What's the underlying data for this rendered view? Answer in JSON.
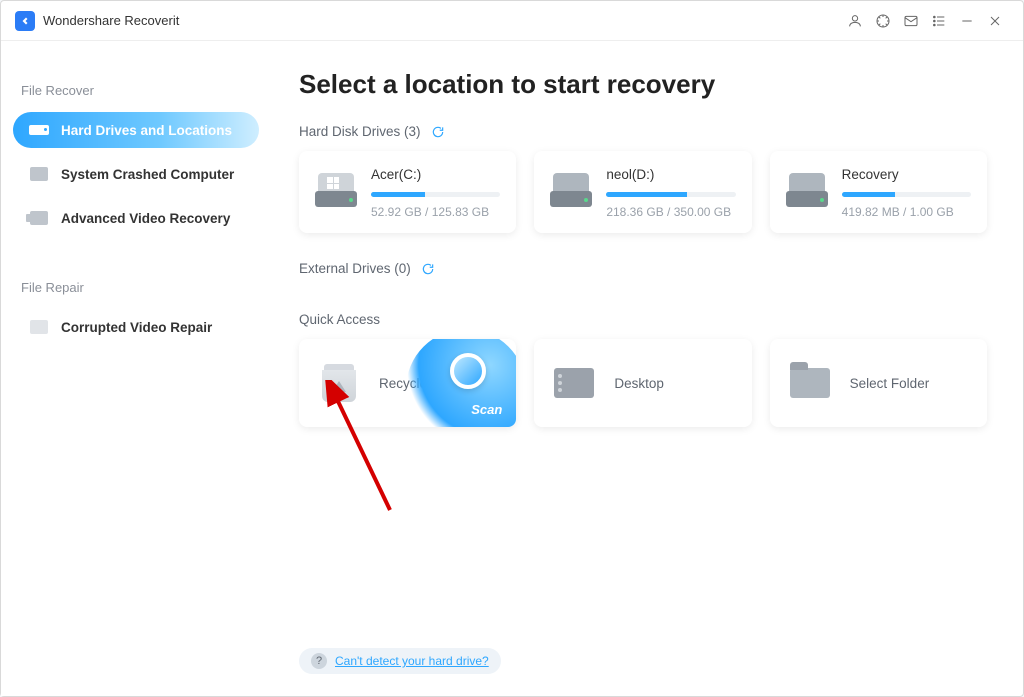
{
  "app": {
    "title": "Wondershare Recoverit"
  },
  "sidebar": {
    "sections": {
      "recover": {
        "title": "File Recover"
      },
      "repair": {
        "title": "File Repair"
      }
    },
    "items": [
      {
        "label": "Hard Drives and Locations"
      },
      {
        "label": "System Crashed Computer"
      },
      {
        "label": "Advanced Video Recovery"
      },
      {
        "label": "Corrupted Video Repair"
      }
    ]
  },
  "main": {
    "title": "Select a location to start recovery",
    "hdd_section": "Hard Disk Drives (3)",
    "ext_section": "External Drives (0)",
    "qa_section": "Quick Access"
  },
  "drives": [
    {
      "name": "Acer(C:)",
      "used": "52.92 GB",
      "total": "125.83 GB",
      "pct": 42
    },
    {
      "name": "neol(D:)",
      "used": "218.36 GB",
      "total": "350.00 GB",
      "pct": 62
    },
    {
      "name": "Recovery",
      "used": "419.82 MB",
      "total": "1.00 GB",
      "pct": 41
    }
  ],
  "quick": {
    "recycle": "Recycle Bin",
    "scan": "Scan",
    "desktop": "Desktop",
    "folder": "Select Folder"
  },
  "footer": {
    "help_link": "Can't detect your hard drive?"
  }
}
